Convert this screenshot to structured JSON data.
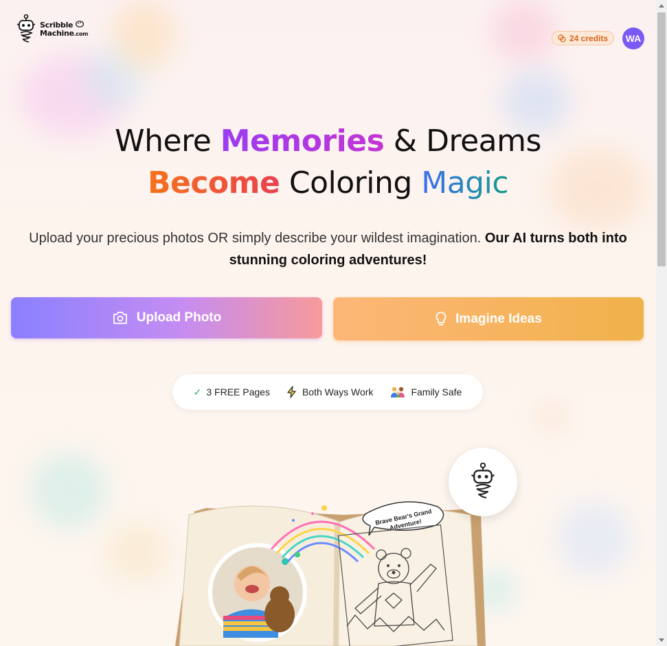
{
  "header": {
    "logo_line1": "Scribble",
    "logo_line2": "Machine",
    "logo_suffix": ".com",
    "credits_label": "24 credits",
    "avatar_initials": "WA"
  },
  "hero": {
    "line1_part1": "Where ",
    "line1_highlight": "Memories",
    "line1_part2": " & Dreams",
    "line2_highlight1": "Become",
    "line2_part": " Coloring ",
    "line2_highlight2": "Magic",
    "subtitle_plain": "Upload your precious photos OR simply describe your wildest imagination. ",
    "subtitle_bold": "Our AI turns both into stunning coloring adventures!"
  },
  "actions": {
    "upload_label": "Upload Photo",
    "imagine_label": "Imagine Ideas"
  },
  "features": [
    {
      "icon": "check-icon",
      "label": "3 FREE Pages"
    },
    {
      "icon": "lightning-icon",
      "label": "Both Ways Work"
    },
    {
      "icon": "family-icon",
      "label": "Family Safe"
    }
  ],
  "illustration": {
    "bubble_text": "Brave Bear's Grand Adventure!"
  },
  "colors": {
    "purple_accent": "#9b3cf0",
    "orange_accent": "#f5731c",
    "blue_accent": "#3d6ff0",
    "credits_text": "#d9661c",
    "avatar_bg": "#7a5af5"
  }
}
